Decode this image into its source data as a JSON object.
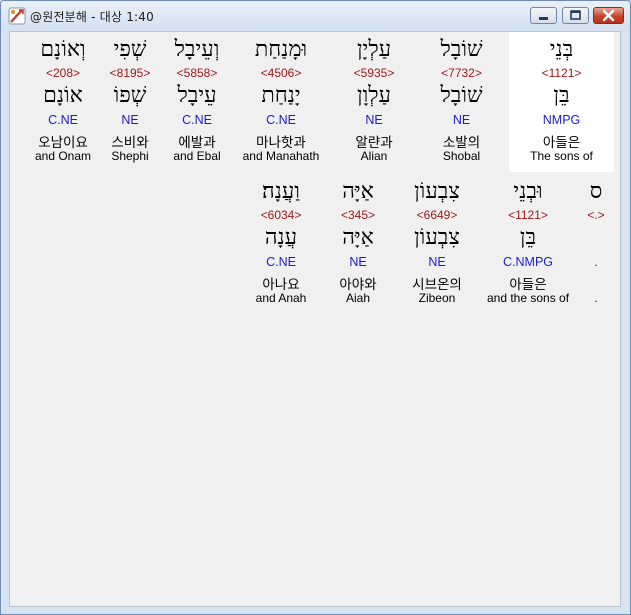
{
  "window": {
    "title": "@원전분해 - 대상 1:40"
  },
  "verse": {
    "row1": [
      {
        "heb": "בְּנֵי",
        "strong": "<1121>",
        "lex": "בֵּן",
        "gram": "NMPG",
        "kor": "아들은",
        "eng": "The sons of",
        "selected": true
      },
      {
        "heb": "שׁוֹבָל",
        "strong": "<7732>",
        "lex": "שׁוֹבָל",
        "gram": "NE",
        "kor": "소발의",
        "eng": "Shobal",
        "selected": false
      },
      {
        "heb": "עַלְיָן",
        "strong": "<5935>",
        "lex": "עַלְוָן",
        "gram": "NE",
        "kor": "알랸과",
        "eng": "Alian",
        "selected": false
      },
      {
        "heb": "וּמָנַחַת",
        "strong": "<4506>",
        "lex": "יָנַחַת",
        "gram": "C.NE",
        "kor": "마나핫과",
        "eng": "and Manahath",
        "selected": false
      },
      {
        "heb": "וְעֵיבָל",
        "strong": "<5858>",
        "lex": "עֵיבָל",
        "gram": "C.NE",
        "kor": "에발과",
        "eng": "and Ebal",
        "selected": false
      },
      {
        "heb": "שְׁפִי",
        "strong": "<8195>",
        "lex": "שְׁפוֹ",
        "gram": "NE",
        "kor": "스비와",
        "eng": "Shephi",
        "selected": false
      },
      {
        "heb": "וְאוֹנָם",
        "strong": "<208>",
        "lex": "אוֹנָם",
        "gram": "C.NE",
        "kor": "오남이요",
        "eng": "and Onam",
        "selected": false
      }
    ],
    "row2": [
      {
        "heb": "ס",
        "strong": "<.>",
        "lex": "",
        "gram": ".",
        "kor": "",
        "eng": ".",
        "selected": false
      },
      {
        "heb": "וּבְנֵי",
        "strong": "<1121>",
        "lex": "בֵּן",
        "gram": "C.NMPG",
        "kor": "아들은",
        "eng": "and the sons of",
        "selected": false
      },
      {
        "heb": "צִבְעוֹן",
        "strong": "<6649>",
        "lex": "צִבְעוֹן",
        "gram": "NE",
        "kor": "시브온의",
        "eng": "Zibeon",
        "selected": false
      },
      {
        "heb": "אַיָּה",
        "strong": "<345>",
        "lex": "אַיָּה",
        "gram": "NE",
        "kor": "아야와",
        "eng": "Aiah",
        "selected": false
      },
      {
        "heb": "וַעֲנָה׃",
        "strong": "<6034>",
        "lex": "עֲנָה",
        "gram": "C.NE",
        "kor": "아나요",
        "eng": "and Anah",
        "selected": false
      }
    ]
  }
}
